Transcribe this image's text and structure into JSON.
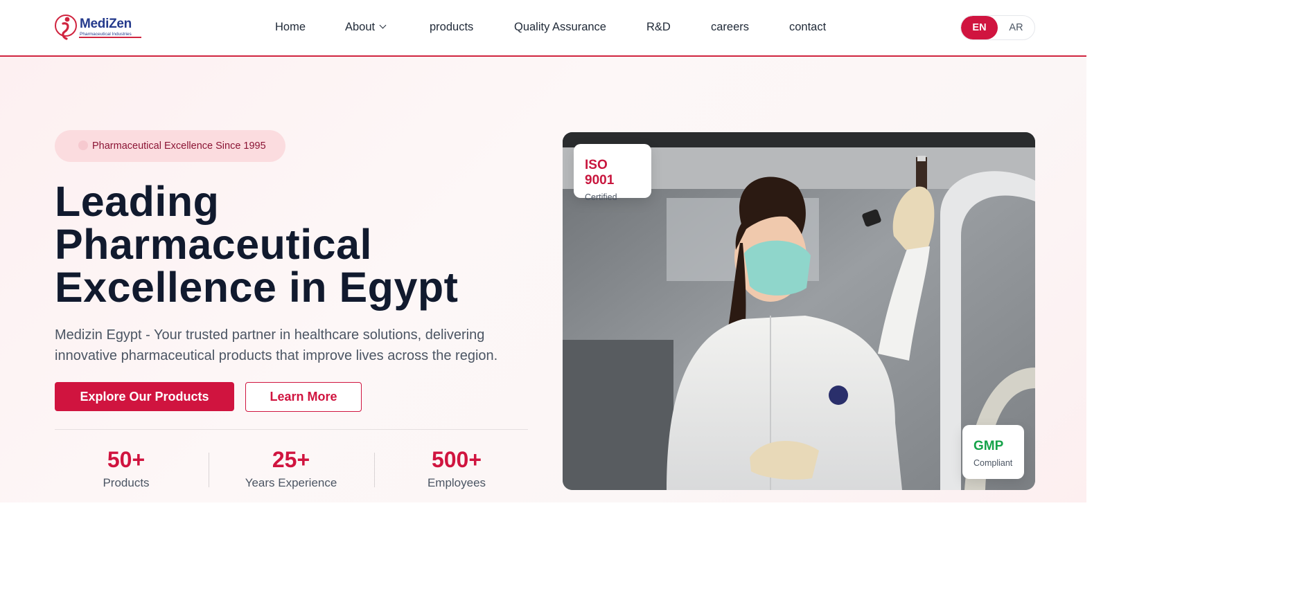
{
  "brand": {
    "name": "MediZen",
    "tagline": "Pharmaceutical Industries",
    "primary_color": "#d0143f",
    "navy_color": "#243a8c"
  },
  "nav": {
    "items": [
      {
        "label": "Home"
      },
      {
        "label": "About"
      },
      {
        "label": "products"
      },
      {
        "label": "Quality Assurance"
      },
      {
        "label": "R&D"
      },
      {
        "label": "careers"
      },
      {
        "label": "contact"
      }
    ],
    "lang": {
      "active": "EN",
      "other": "AR"
    }
  },
  "hero": {
    "badge": "Pharmaceutical Excellence Since 1995",
    "title_lines": [
      "Leading",
      "Pharmaceutical",
      "Excellence in Egypt"
    ],
    "description": "Medizin Egypt - Your trusted partner in healthcare solutions, delivering innovative pharmaceutical products that improve lives across the region.",
    "primary_button": "Explore Our Products",
    "secondary_button": "Learn More",
    "stats": [
      {
        "value": "50+",
        "label": "Products"
      },
      {
        "value": "25+",
        "label": "Years Experience"
      },
      {
        "value": "500+",
        "label": "Employees"
      }
    ]
  },
  "image_cards": {
    "iso": {
      "title": "ISO 9001",
      "subtitle": "Certified",
      "color": "#c8163e"
    },
    "gmp": {
      "title": "GMP",
      "subtitle": "Compliant",
      "color": "#16a34a"
    }
  }
}
